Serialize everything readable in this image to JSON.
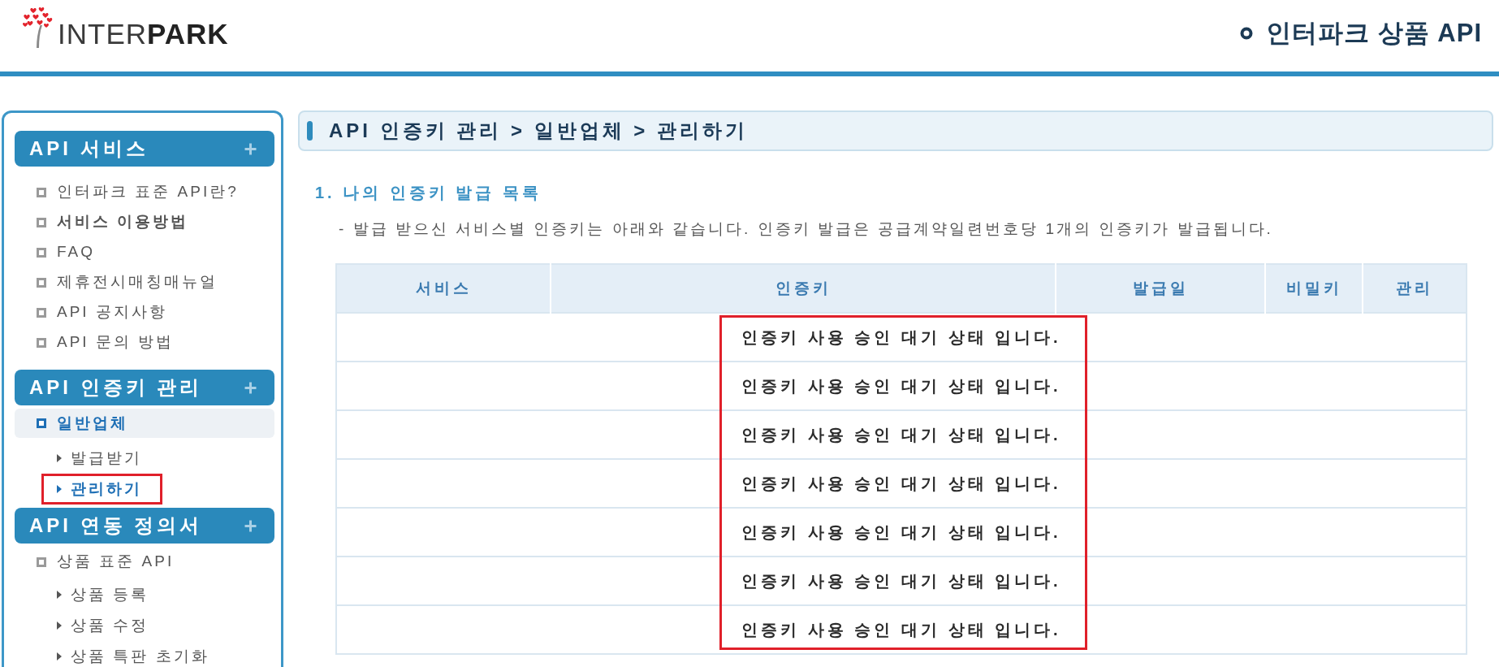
{
  "header": {
    "logo": "INTER**PARK**",
    "title": "인터파크 상품 API"
  },
  "sidebar": {
    "sections": [
      {
        "title": "API 서비스",
        "items": [
          {
            "label": "인터파크 표준 API란?",
            "bold": false,
            "selected": false
          },
          {
            "label": "서비스 이용방법",
            "bold": true,
            "selected": false
          },
          {
            "label": "FAQ",
            "bold": false,
            "selected": false
          },
          {
            "label": "제휴전시매칭매뉴얼",
            "bold": false,
            "selected": false
          },
          {
            "label": "API 공지사항",
            "bold": false,
            "selected": false
          },
          {
            "label": "API 문의 방법",
            "bold": false,
            "selected": false
          }
        ]
      },
      {
        "title": "API 인증키 관리",
        "items": [
          {
            "label": "일반업체",
            "bold": true,
            "selected": true,
            "children": [
              {
                "label": "발급받기",
                "selected": false,
                "highlighted": false
              },
              {
                "label": "관리하기",
                "selected": true,
                "highlighted": true
              }
            ]
          }
        ]
      },
      {
        "title": "API 연동 정의서",
        "items": [
          {
            "label": "상품 표준 API",
            "bold": false,
            "selected": false,
            "children": [
              {
                "label": "상품 등록",
                "selected": false,
                "highlighted": false
              },
              {
                "label": "상품 수정",
                "selected": false,
                "highlighted": false
              },
              {
                "label": "상품 특판 초기화",
                "selected": false,
                "highlighted": false
              }
            ]
          }
        ]
      }
    ]
  },
  "main": {
    "breadcrumb": "API 인증키 관리 > 일반업체 > 관리하기",
    "heading": "1. 나의 인증키 발급 목록",
    "description": "- 발급 받으신 서비스별 인증키는 아래와 같습니다. 인증키 발급은 공급계약일련번호당 1개의 인증키가 발급됩니다.",
    "table": {
      "columns": [
        "서비스",
        "인증키",
        "발급일",
        "비밀키",
        "관리"
      ],
      "highlight_box": true,
      "rows": [
        {
          "message": "인증키 사용 승인 대기 상태 입니다."
        },
        {
          "message": "인증키 사용 승인 대기 상태 입니다."
        },
        {
          "message": "인증키 사용 승인 대기 상태 입니다."
        },
        {
          "message": "인증키 사용 승인 대기 상태 입니다."
        },
        {
          "message": "인증키 사용 승인 대기 상태 입니다."
        },
        {
          "message": "인증키 사용 승인 대기 상태 입니다."
        },
        {
          "message": "인증키 사용 승인 대기 상태 입니다."
        }
      ]
    }
  }
}
